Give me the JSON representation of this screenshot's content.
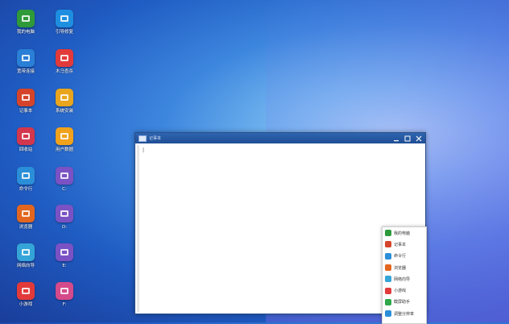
{
  "desktop": {
    "icons": [
      {
        "label": "我的电脑",
        "icon": "computer-icon",
        "color": "#2e9a3a"
      },
      {
        "label": "引导修复",
        "icon": "tools-icon",
        "color": "#1e8ee0"
      },
      {
        "label": "宽带连接",
        "icon": "network-globe-icon",
        "color": "#2a7fd6"
      },
      {
        "label": "木马查杀",
        "icon": "medical-kit-icon",
        "color": "#e23a3a"
      },
      {
        "label": "记事本",
        "icon": "notepad-icon",
        "color": "#d5442a"
      },
      {
        "label": "系统安装",
        "icon": "windows-logo-icon",
        "color": "#e8a51d"
      },
      {
        "label": "回收站",
        "icon": "recycle-bin-icon",
        "color": "#d3374d"
      },
      {
        "label": "用户数据",
        "icon": "folder-icon",
        "color": "#f0a21d"
      },
      {
        "label": "命令行",
        "icon": "terminal-icon",
        "color": "#2a8fd8"
      },
      {
        "label": "C:",
        "icon": "drive-c-icon",
        "color": "#7a52c4"
      },
      {
        "label": "浏览器",
        "icon": "firefox-icon",
        "color": "#e2661f"
      },
      {
        "label": "D:",
        "icon": "drive-d-icon",
        "color": "#7a52c4"
      },
      {
        "label": "网络向导",
        "icon": "home-network-icon",
        "color": "#35a4d8"
      },
      {
        "label": "E:",
        "icon": "drive-e-icon",
        "color": "#7a52c4"
      },
      {
        "label": "小游戏",
        "icon": "gamepad-icon",
        "color": "#e23a3a"
      },
      {
        "label": "F:",
        "icon": "drive-f-icon",
        "color": "#d54a8a"
      }
    ]
  },
  "window": {
    "title": "记事本",
    "cursor_text": "|"
  },
  "popup_menu": {
    "items": [
      {
        "label": "我的电脑",
        "icon": "computer-icon",
        "color": "#2e9a3a"
      },
      {
        "label": "记事本",
        "icon": "notepad-icon",
        "color": "#d5442a"
      },
      {
        "label": "命令行",
        "icon": "terminal-icon",
        "color": "#2a8fd8"
      },
      {
        "label": "浏览器",
        "icon": "firefox-icon",
        "color": "#e2661f"
      },
      {
        "label": "网络向导",
        "icon": "home-network-icon",
        "color": "#35a4d8"
      },
      {
        "label": "小游戏",
        "icon": "gamepad-icon",
        "color": "#e23a3a"
      },
      {
        "label": "截屏助手",
        "icon": "scissors-icon",
        "color": "#2ea84a"
      },
      {
        "label": "调整分辨率",
        "icon": "display-icon",
        "color": "#2a8fd8"
      }
    ]
  }
}
